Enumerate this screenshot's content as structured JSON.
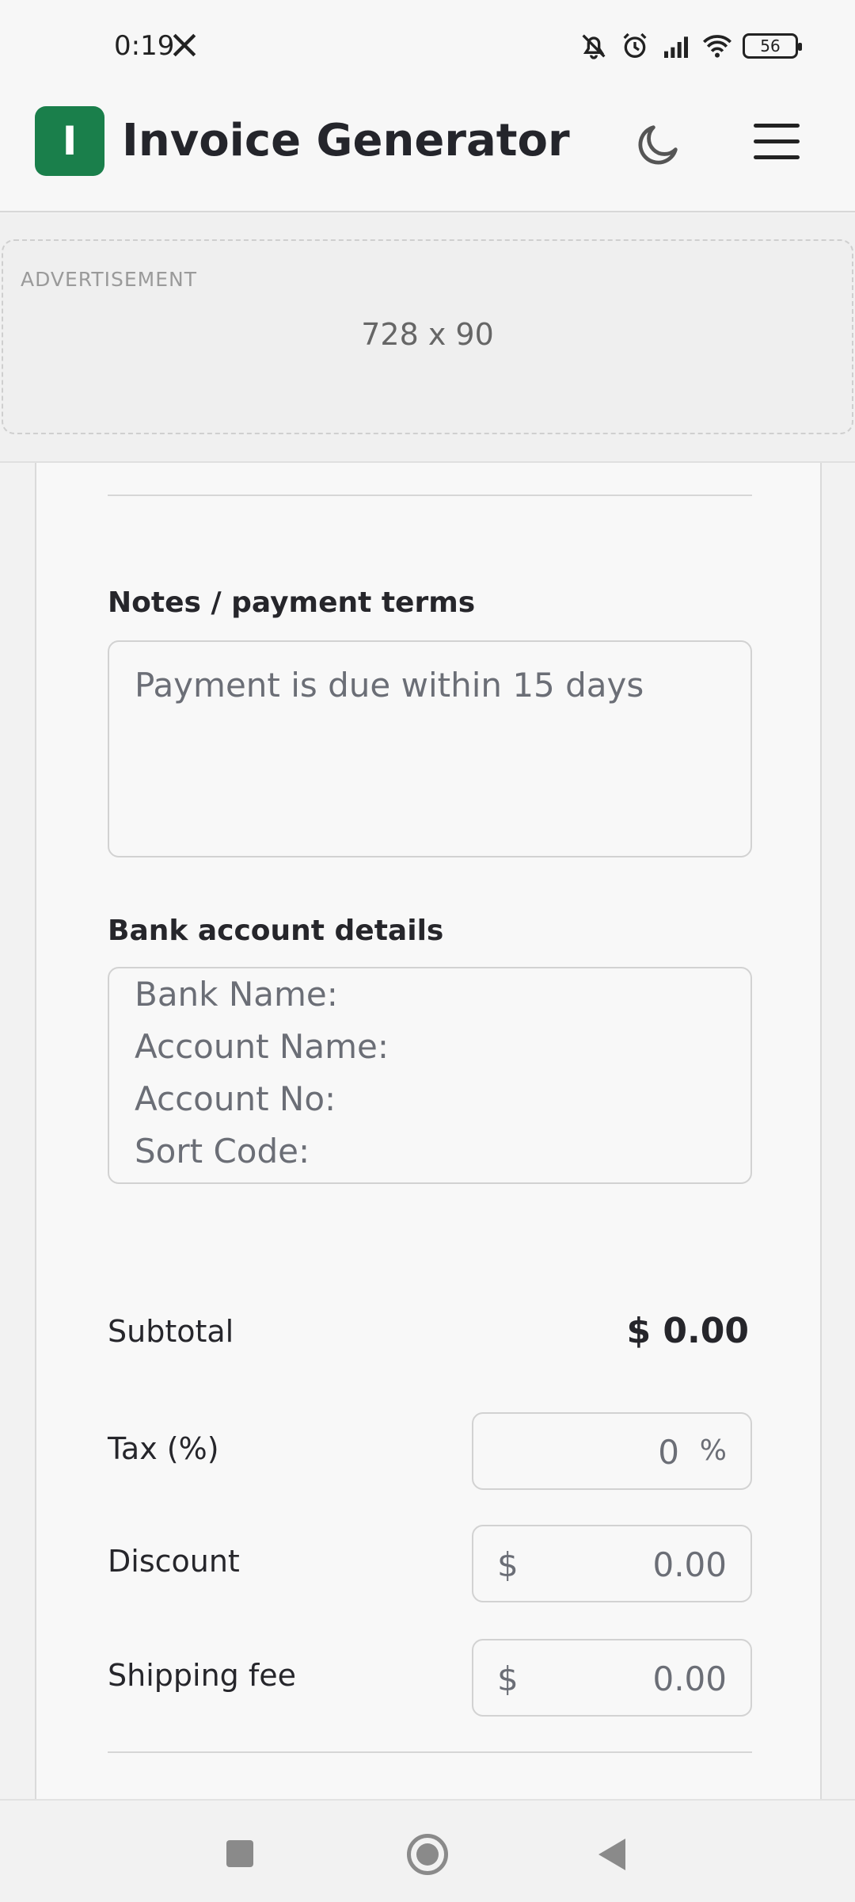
{
  "status": {
    "time": "0:19",
    "battery": "56"
  },
  "header": {
    "logo_letter": "I",
    "title": "Invoice Generator"
  },
  "ad": {
    "label": "ADVERTISEMENT",
    "size": "728 x 90"
  },
  "notes": {
    "label": "Notes / payment terms",
    "placeholder": "Payment is due within 15 days"
  },
  "bank": {
    "label": "Bank account details",
    "lines": [
      "Bank Name:",
      "Account Name:",
      "Account No:",
      "Sort Code:"
    ]
  },
  "totals": {
    "subtotal_label": "Subtotal",
    "subtotal_value": "$ 0.00",
    "tax_label": "Tax (%)",
    "tax_value": "0",
    "tax_suffix": "%",
    "discount_label": "Discount",
    "discount_prefix": "$",
    "discount_value": "0.00",
    "shipping_label": "Shipping fee",
    "shipping_prefix": "$",
    "shipping_value": "0.00"
  },
  "colors": {
    "brand": "#1a7f4b"
  },
  "icons": [
    "x-logo-icon",
    "bell-off-icon",
    "alarm-icon",
    "signal-icon",
    "wifi-icon",
    "battery-icon",
    "moon-icon",
    "menu-icon",
    "nav-recents-icon",
    "nav-home-icon",
    "nav-back-icon"
  ]
}
